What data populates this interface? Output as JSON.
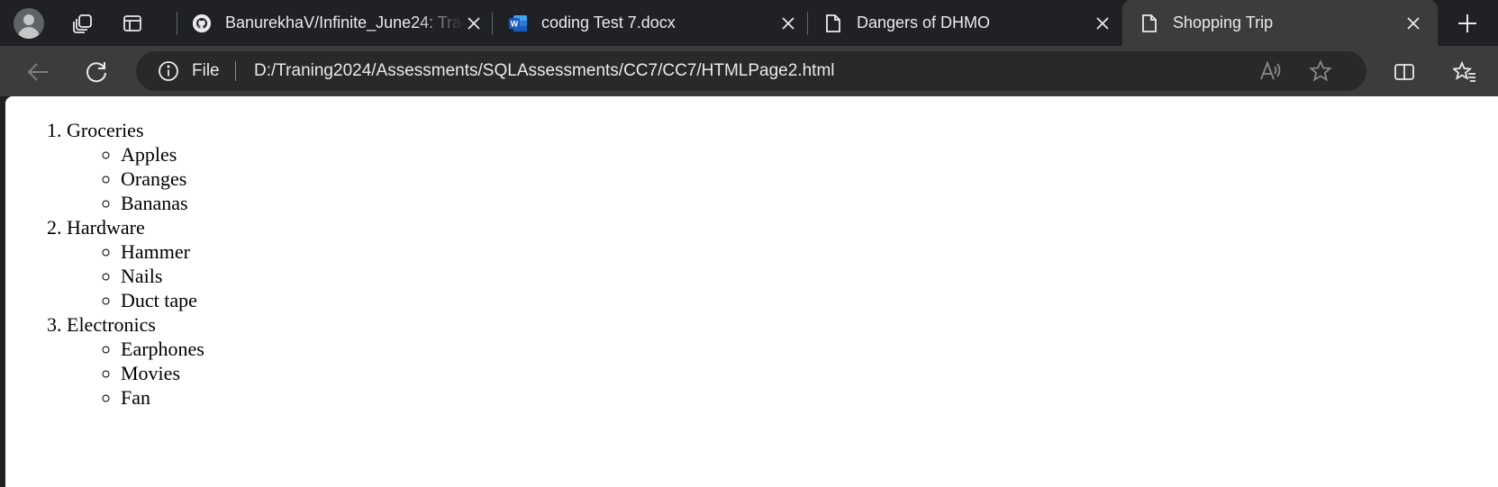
{
  "tabs": [
    {
      "title": "BanurekhaV/Infinite_June24: Tra",
      "icon": "github-icon",
      "active": false
    },
    {
      "title": "coding Test 7.docx",
      "icon": "word-icon",
      "active": false
    },
    {
      "title": "Dangers of DHMO",
      "icon": "page-icon",
      "active": false
    },
    {
      "title": "Shopping Trip",
      "icon": "page-icon",
      "active": true
    }
  ],
  "address_bar": {
    "scheme": "File",
    "url": "D:/Traning2024/Assessments/SQLAssessments/CC7/CC7/HTMLPage2.html"
  },
  "page": {
    "list": [
      {
        "label": "Groceries",
        "items": [
          "Apples",
          "Oranges",
          "Bananas"
        ]
      },
      {
        "label": "Hardware",
        "items": [
          "Hammer",
          "Nails",
          "Duct tape"
        ]
      },
      {
        "label": "Electronics",
        "items": [
          "Earphones",
          "Movies",
          "Fan"
        ]
      }
    ]
  },
  "colors": {
    "tabstrip": "#202124",
    "toolbar": "#3c3c3c",
    "omnibox": "#292929",
    "text": "#e8eaed",
    "page_bg": "#ffffff"
  }
}
